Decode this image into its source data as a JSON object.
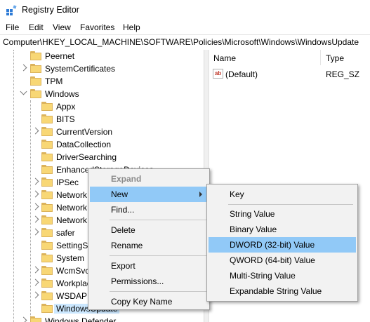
{
  "window": {
    "title": "Registry Editor"
  },
  "menubar": [
    "File",
    "Edit",
    "View",
    "Favorites",
    "Help"
  ],
  "address": "Computer\\HKEY_LOCAL_MACHINE\\SOFTWARE\\Policies\\Microsoft\\Windows\\WindowsUpdate",
  "tree": {
    "items": [
      {
        "label": "Peernet"
      },
      {
        "label": "SystemCertificates"
      },
      {
        "label": "TPM"
      },
      {
        "label": "Windows"
      },
      {
        "label": "Appx"
      },
      {
        "label": "BITS"
      },
      {
        "label": "CurrentVersion"
      },
      {
        "label": "DataCollection"
      },
      {
        "label": "DriverSearching"
      },
      {
        "label": "EnhancedStorageDevices"
      },
      {
        "label": "IPSec"
      },
      {
        "label": "Network"
      },
      {
        "label": "Network"
      },
      {
        "label": "Network"
      },
      {
        "label": "safer"
      },
      {
        "label": "SettingSync"
      },
      {
        "label": "System"
      },
      {
        "label": "WcmSvc"
      },
      {
        "label": "Workplace"
      },
      {
        "label": "WSDAPI"
      },
      {
        "label": "WindowsUpdate"
      },
      {
        "label": "Windows Defender"
      }
    ]
  },
  "values_pane": {
    "columns": [
      "Name",
      "Type"
    ],
    "rows": [
      {
        "name": "(Default)",
        "type": "REG_SZ",
        "icon": "string-value-icon"
      }
    ]
  },
  "context_menu": {
    "items": [
      "Expand",
      "New",
      "Find...",
      "Delete",
      "Rename",
      "Export",
      "Permissions...",
      "Copy Key Name"
    ]
  },
  "submenu": {
    "items": [
      "Key",
      "String Value",
      "Binary Value",
      "DWORD (32-bit) Value",
      "QWORD (64-bit) Value",
      "Multi-String Value",
      "Expandable String Value"
    ]
  },
  "colors": {
    "highlight": "#91c9f7",
    "selection": "#cce8ff",
    "folder": "#f8d775"
  }
}
